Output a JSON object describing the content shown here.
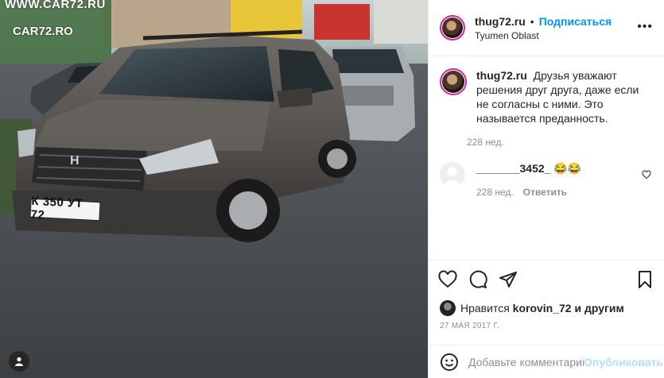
{
  "photo": {
    "watermark_top": "WWW.CAR72.RU",
    "watermark_logo": "CAR72.RO",
    "plate_text": "К 350 УТ 72",
    "tag_icon": "user-tag-icon"
  },
  "header": {
    "username": "thug72.ru",
    "separator": "•",
    "follow_label": "Подписаться",
    "location": "Tyumen Oblast",
    "more_icon": "more-horizontal-icon"
  },
  "caption": {
    "username": "thug72.ru",
    "text": "Друзья уважают решения друг друга, даже если не согласны с ними. Это называется преданность.",
    "time": "228 нед."
  },
  "comment": {
    "username": "_______3452_",
    "text": "😂😂",
    "time": "228 нед.",
    "reply_label": "Ответить"
  },
  "actions": {
    "like_icon": "heart-icon",
    "comment_icon": "comment-icon",
    "share_icon": "paper-plane-icon",
    "save_icon": "bookmark-icon"
  },
  "likes": {
    "prefix": "Нравится",
    "user": "korovin_72",
    "suffix": "и другим"
  },
  "date": "27 МАЯ 2017 Г.",
  "add_comment": {
    "placeholder": "Добавьте комментарий...",
    "publish_label": "Опубликовать"
  }
}
